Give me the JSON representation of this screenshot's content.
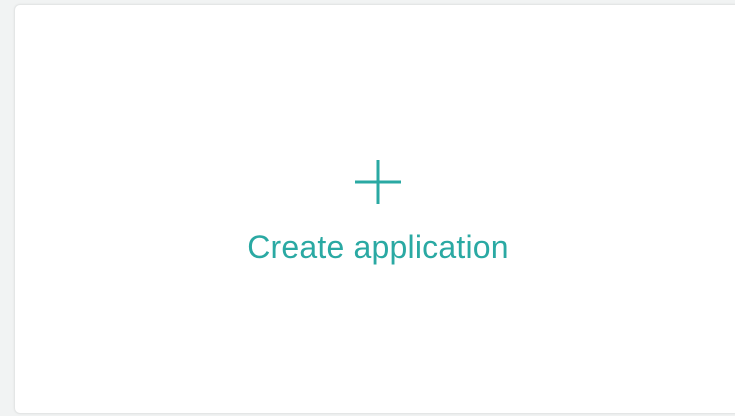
{
  "create_card": {
    "label": "Create application",
    "icon": "plus-icon",
    "accent_color": "#2aa9a3"
  }
}
